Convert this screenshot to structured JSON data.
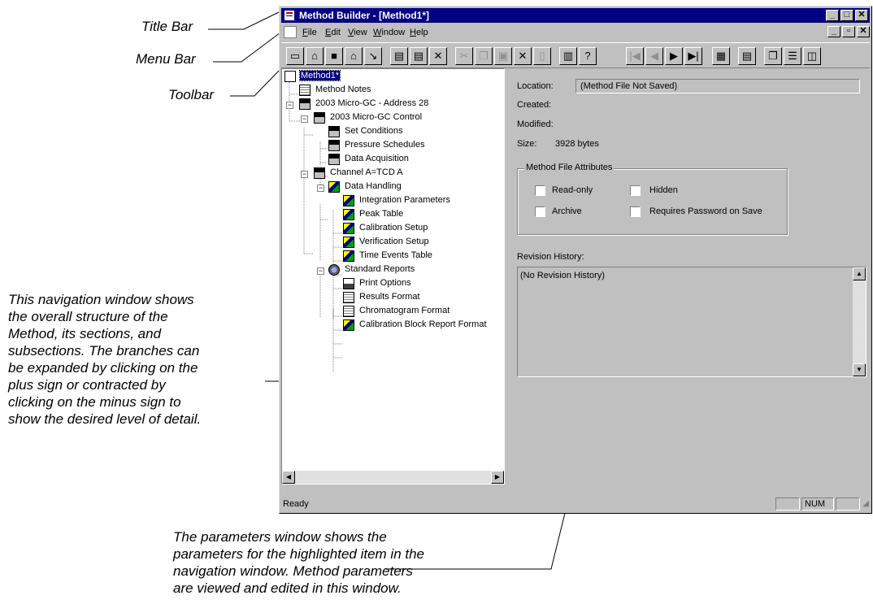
{
  "callouts": {
    "title_bar": "Title Bar",
    "menu_bar": "Menu Bar",
    "toolbar": "Toolbar",
    "navigation_lines": [
      "This navigation window shows",
      "the overall structure of the",
      "Method, its sections, and",
      "subsections.  The branches can",
      "be expanded by clicking on the",
      "plus sign or contracted by",
      "clicking on the minus sign to",
      "show the desired level of detail."
    ],
    "parameters_lines": [
      "The parameters window shows the",
      "parameters for the highlighted item in the",
      "navigation window.  Method parameters",
      "are viewed and edited in this window."
    ]
  },
  "window": {
    "title": "Method Builder - [Method1*]",
    "caption_buttons": [
      "_",
      "□",
      "✕"
    ],
    "mdi_buttons": [
      "_",
      "▫",
      "✕"
    ]
  },
  "menu": [
    "File",
    "Edit",
    "View",
    "Window",
    "Help"
  ],
  "toolbar_icons": [
    "new-icon",
    "open-icon",
    "save-icon",
    "open-folder-icon",
    "wrench-icon",
    "method-new-icon",
    "method-import-icon",
    "method-delete-icon",
    "cut-icon",
    "copy-icon",
    "paste-icon",
    "delete-icon",
    "properties-icon",
    "print-icon",
    "help-icon",
    "first-icon",
    "previous-icon",
    "next-icon",
    "last-icon",
    "view-tree-icon",
    "view-green-icon",
    "view-cascade-icon",
    "view-horizontal-icon",
    "view-vertical-icon"
  ],
  "tree": [
    "Method1*",
    "Method Notes",
    "2003 Micro-GC - Address 28",
    "2003 Micro-GC Control",
    "Set Conditions",
    "Pressure Schedules",
    "Data Acquisition",
    "Channel A=TCD A",
    "Data Handling",
    "Integration Parameters",
    "Peak Table",
    "Calibration Setup",
    "Verification Setup",
    "Time Events Table",
    "Standard Reports",
    "Print Options",
    "Results Format",
    "Chromatogram Format",
    "Calibration Block Report Format"
  ],
  "params": {
    "location_label": "Location:",
    "location_value": "(Method File Not Saved)",
    "created_label": "Created:",
    "modified_label": "Modified:",
    "size_label": "Size:",
    "size_value": "3928 bytes",
    "attributes_group": "Method File Attributes",
    "read_only": "Read-only",
    "hidden": "Hidden",
    "archive": "Archive",
    "requires_password": "Requires Password on Save",
    "revision_label": "Revision History:",
    "revision_value": "(No Revision History)"
  },
  "status": {
    "text": "Ready",
    "num": "NUM"
  }
}
